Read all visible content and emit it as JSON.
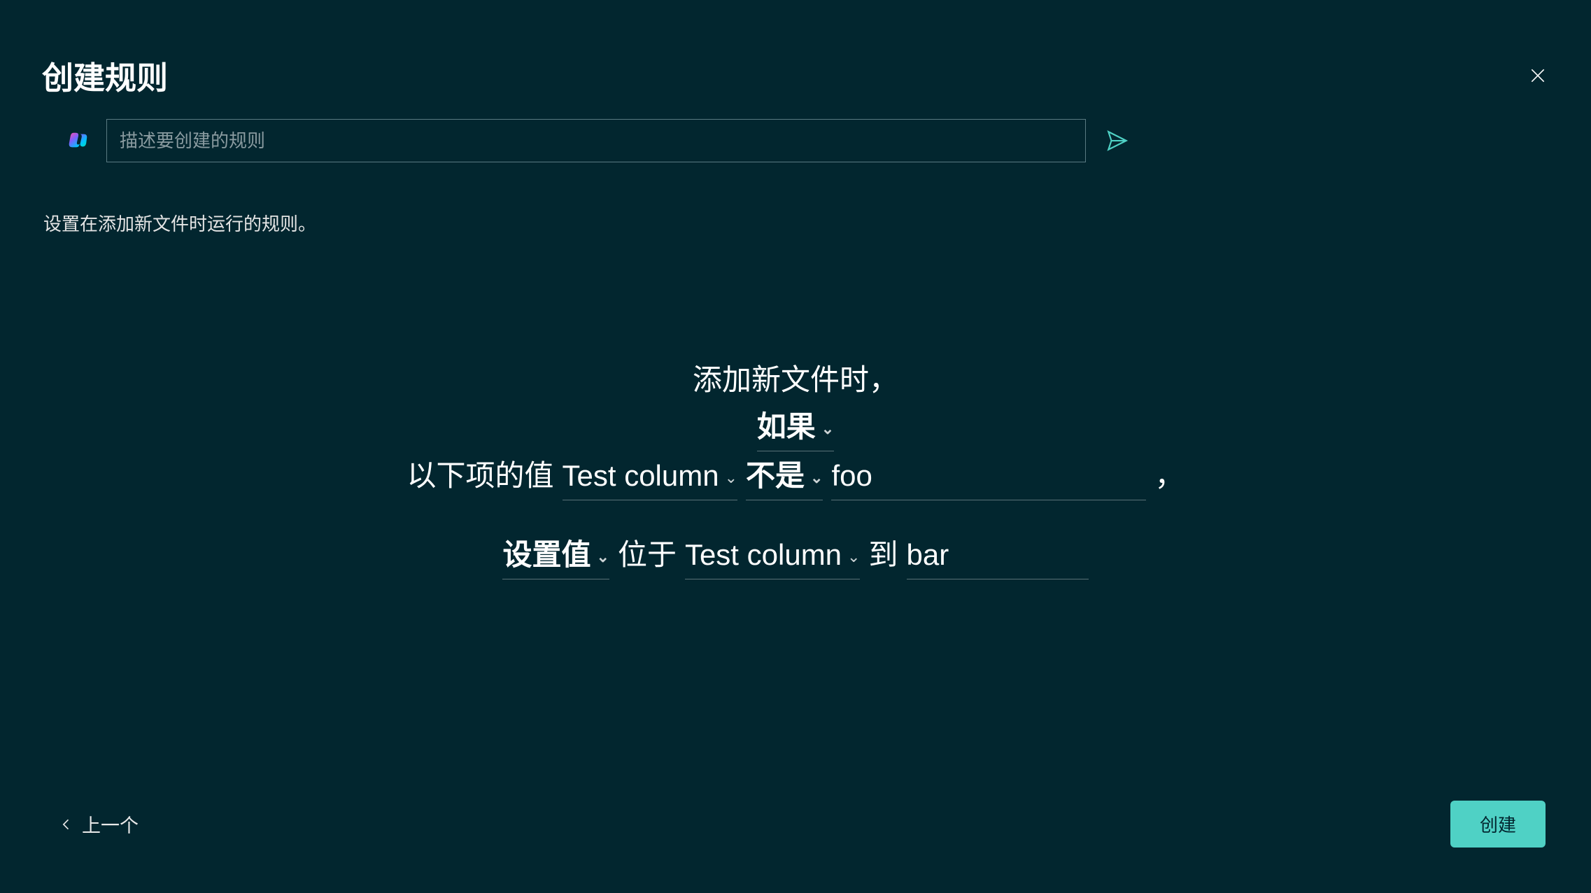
{
  "header": {
    "title": "创建规则"
  },
  "input": {
    "placeholder": "描述要创建的规则"
  },
  "description": "设置在添加新文件时运行的规则。",
  "rule": {
    "trigger_text": "添加新文件时，",
    "condition_label": "如果",
    "value_of_label": "以下项的值",
    "condition_column": "Test column",
    "operator": "不是",
    "condition_value": "foo",
    "comma": "，",
    "action_label": "设置值",
    "in_label": "位于",
    "action_column": "Test column",
    "to_label": "到",
    "action_value": "bar"
  },
  "footer": {
    "back_label": "上一个",
    "create_label": "创建"
  }
}
